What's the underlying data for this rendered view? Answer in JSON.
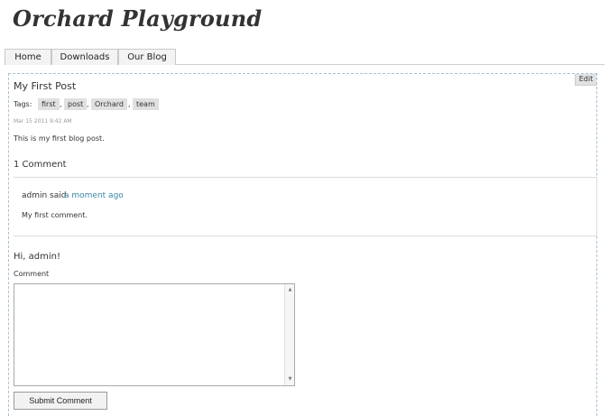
{
  "site": {
    "title": "Orchard Playground"
  },
  "nav": {
    "tabs": [
      {
        "label": "Home"
      },
      {
        "label": "Downloads"
      },
      {
        "label": "Our Blog"
      }
    ]
  },
  "zone": {
    "edit_label": "Edit"
  },
  "post": {
    "title": "My First Post",
    "tags_label": "Tags:",
    "tags": [
      "first",
      "post",
      "Orchard",
      "team"
    ],
    "tag_separator": ",",
    "date": "Mar 15 2011 9:42 AM",
    "body": "This is my first blog post."
  },
  "comments": {
    "heading": "1 Comment",
    "items": [
      {
        "author_text": "admin said",
        "time": "a moment ago",
        "text": "My first comment."
      }
    ]
  },
  "comment_form": {
    "greeting": "Hi, admin!",
    "label": "Comment",
    "value": "",
    "submit_label": "Submit Comment"
  },
  "icons": {
    "scroll_up": "scroll-up-arrow-icon",
    "scroll_down": "scroll-down-arrow-icon"
  },
  "colors": {
    "link": "#3a86a8",
    "zone_border": "#a8c1d8",
    "date_text": "#999999"
  }
}
